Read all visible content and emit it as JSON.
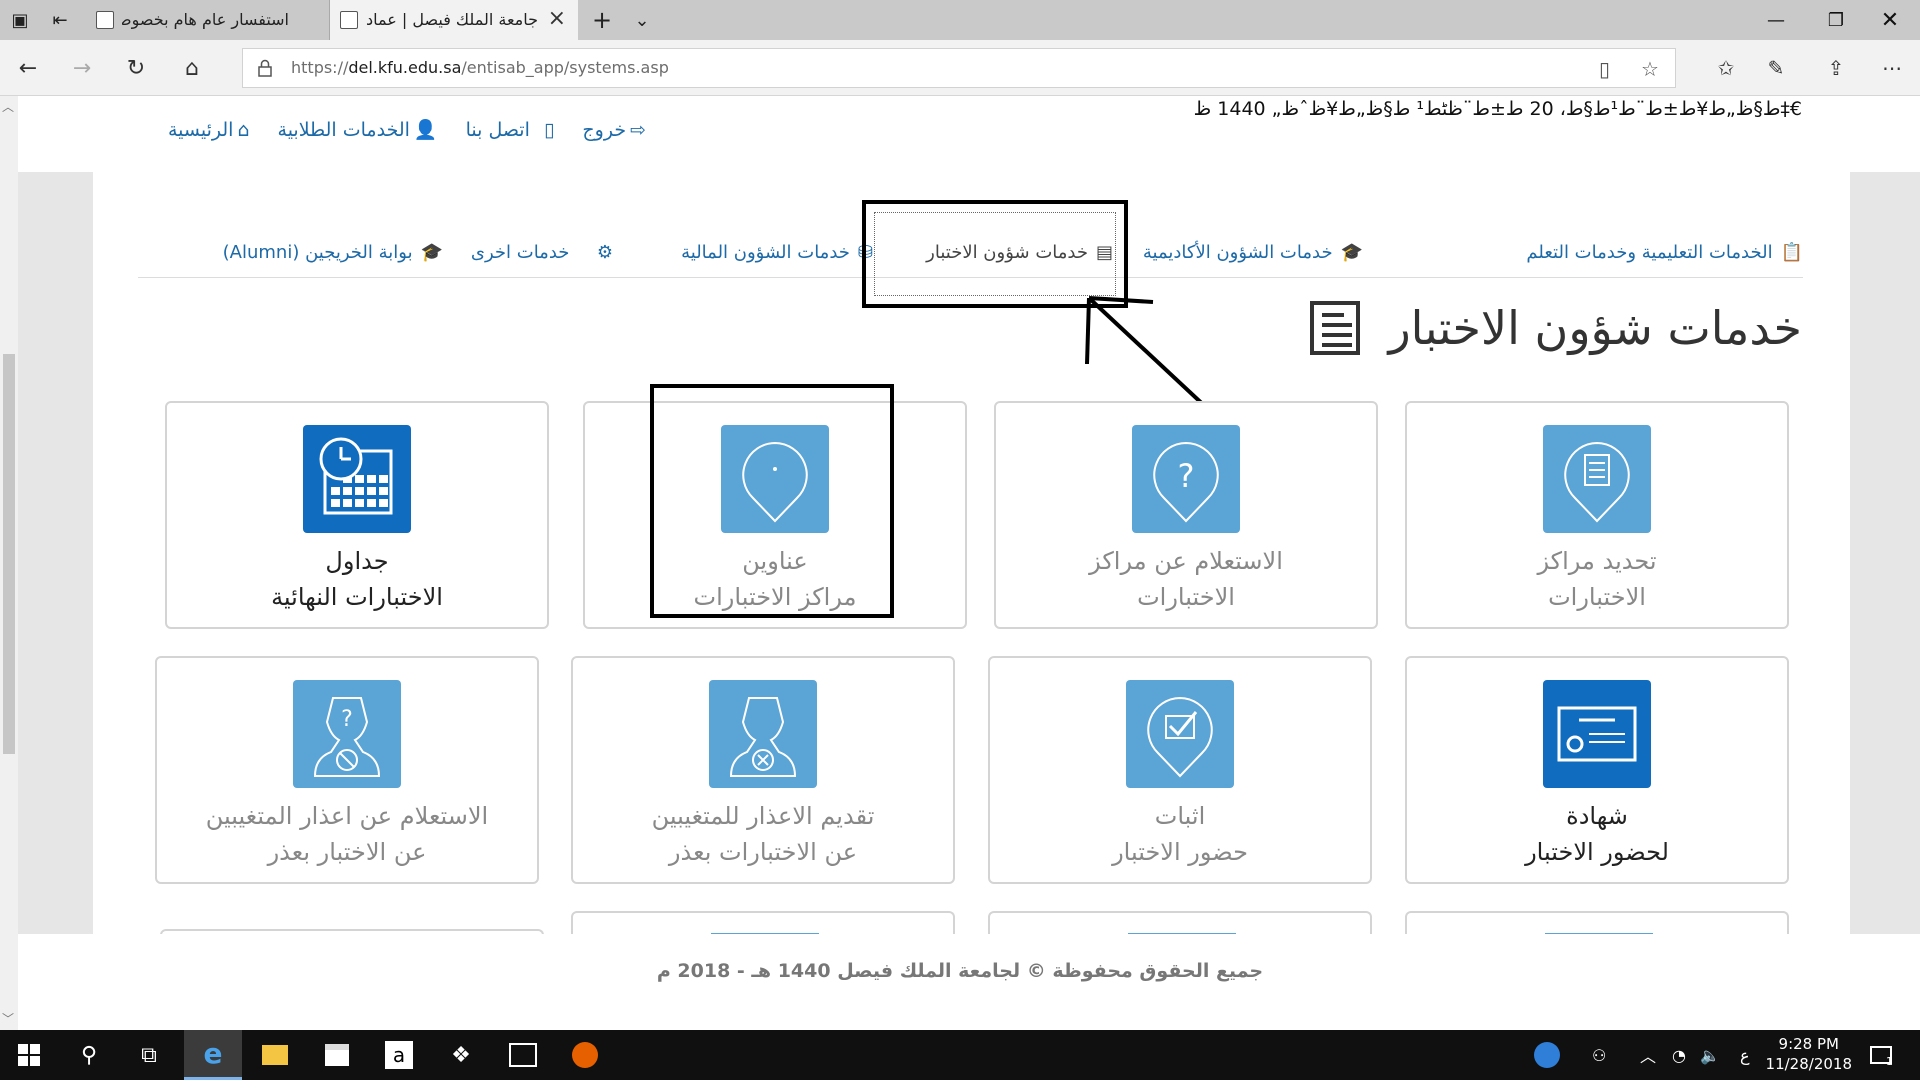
{
  "browser": {
    "tabs": [
      {
        "title": "استفسار عام هام بخصوص مو",
        "active": false
      },
      {
        "title": "جامعة الملك فيصل | عماد",
        "active": true
      }
    ],
    "url_prefix": "https://",
    "url_domain": "del.kfu.edu.sa",
    "url_path": "/entisab_app/systems.asp"
  },
  "site": {
    "garbled_date": "ط§ظ„ط¥ط±ط¨ط¹ط§ط، 20 ط±ط¨ظٹط¹ ط§ظ„ط¥ظˆظ„ 1440 ظ‡€",
    "top_nav": {
      "home": "الرئيسية",
      "student_services": "الخدمات الطلابية",
      "contact": "اتصل بنا",
      "logout": "خروج"
    },
    "sub_nav": {
      "educational": "الخدمات التعليمية وخدمات التعلم",
      "academic": "خدمات الشؤون الأكاديمية",
      "exams": "خدمات شؤون الاختبار",
      "financial": "خدمات الشؤون المالية",
      "other": "خدمات اخرى",
      "alumni": "بوابة الخريجين (Alumni)"
    },
    "heading": "خدمات شؤون الاختبار",
    "cards": [
      {
        "line1": "تحديد مراكز",
        "line2": "الاختبارات"
      },
      {
        "line1": "الاستعلام عن مراكز",
        "line2": "الاختبارات"
      },
      {
        "line1": "عناوين",
        "line2": "مراكز الاختبارات"
      },
      {
        "line1": "جداول",
        "line2": "الاختبارات النهائية"
      },
      {
        "line1": "شهادة",
        "line2": "لحضور الاختبار"
      },
      {
        "line1": "اثبات",
        "line2": "حضور الاختبار"
      },
      {
        "line1": "تقديم الاعذار للمتغيبين",
        "line2": "عن الاختبارات بعذر"
      },
      {
        "line1": "الاستعلام عن اعذار المتغيبين",
        "line2": "عن الاختبار بعذر"
      }
    ],
    "footer": "جميع الحقوق محفوظة © لجامعة الملك فيصل 1440 هـ - 2018 م"
  },
  "taskbar": {
    "time": "9:28 PM",
    "date": "11/28/2018",
    "lang": "ع",
    "notification_count": "1"
  },
  "colors": {
    "link": "#1d6aa8",
    "icon_light": "#5ba4d6",
    "icon_dark": "#0f6cbf"
  }
}
